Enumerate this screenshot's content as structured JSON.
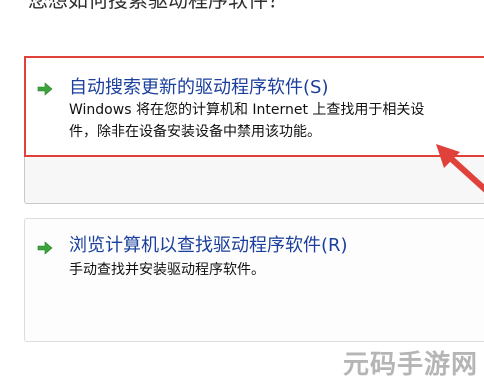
{
  "dialog": {
    "question": "您想如何搜索驱动程序软件？"
  },
  "options": {
    "auto": {
      "icon": "green-arrow-icon",
      "title": "自动搜索更新的驱动程序软件(S)",
      "desc_line1": "Windows 将在您的计算机和 Internet 上查找用于相关设",
      "desc_line2": "件，除非在设备安装设备中禁用该功能。"
    },
    "browse": {
      "icon": "green-arrow-icon",
      "title": "浏览计算机以查找驱动程序软件(R)",
      "desc": "手动查找并安装驱动程序软件。"
    }
  },
  "annotation": {
    "pointer_color": "#e0413b"
  },
  "watermark": {
    "text": "元码手游网"
  }
}
